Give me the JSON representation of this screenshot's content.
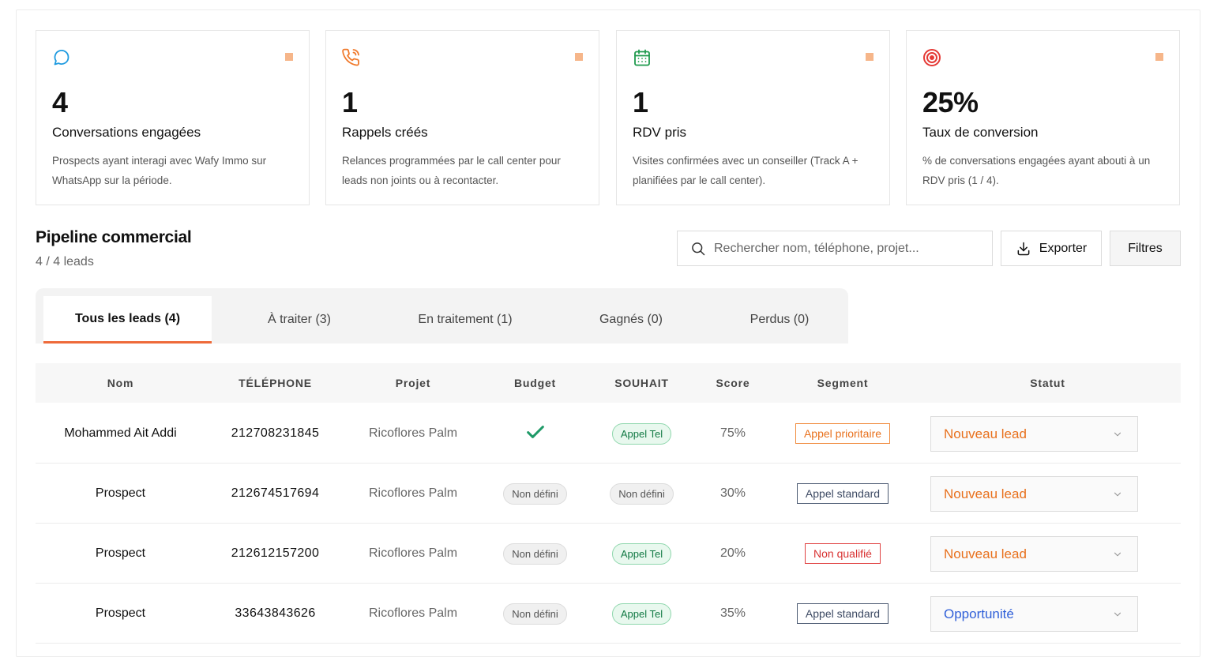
{
  "colors": {
    "accent": "#ee6a3a",
    "card_dot": "#f6b68a",
    "icon_chat": "#1f9be0",
    "icon_phone": "#f07a2c",
    "icon_calendar": "#1f9a4d",
    "icon_target": "#e53935",
    "check": "#1f9a68",
    "status_new": "#e8701c",
    "status_opportunity": "#2f5fd8"
  },
  "cards": [
    {
      "icon": "chat-bubble-icon",
      "value": "4",
      "title": "Conversations engagées",
      "desc": "Prospects ayant interagi avec Wafy Immo sur WhatsApp sur la période."
    },
    {
      "icon": "phone-callback-icon",
      "value": "1",
      "title": "Rappels créés",
      "desc": "Relances programmées par le call center pour leads non joints ou à recontacter."
    },
    {
      "icon": "calendar-icon",
      "value": "1",
      "title": "RDV pris",
      "desc": "Visites confirmées avec un conseiller (Track A + planifiées par le call center)."
    },
    {
      "icon": "target-icon",
      "value": "25%",
      "title": "Taux de conversion",
      "desc": "% de conversations engagées ayant abouti à un RDV pris (1 / 4)."
    }
  ],
  "pipeline": {
    "title": "Pipeline commercial",
    "subtitle": "4 / 4 leads",
    "search_placeholder": "Rechercher nom, téléphone, projet...",
    "export_label": "Exporter",
    "filters_label": "Filtres"
  },
  "tabs": [
    {
      "label": "Tous les leads (4)",
      "active": true
    },
    {
      "label": "À traiter (3)",
      "active": false
    },
    {
      "label": "En traitement (1)",
      "active": false
    },
    {
      "label": "Gagnés (0)",
      "active": false
    },
    {
      "label": "Perdus (0)",
      "active": false
    }
  ],
  "table": {
    "headers": [
      "Nom",
      "TÉLÉPHONE",
      "Projet",
      "Budget",
      "SOUHAIT",
      "Score",
      "Segment",
      "Statut"
    ],
    "rows": [
      {
        "name": "Mohammed Ait Addi",
        "phone": "212708231845",
        "project": "Ricoflores Palm",
        "budget": "check-icon",
        "souhait": "Appel Tel",
        "souhait_style": "green",
        "score": "75%",
        "segment": "Appel prioritaire",
        "segment_style": "orange",
        "status": "Nouveau lead",
        "status_style": "orange"
      },
      {
        "name": "Prospect",
        "phone": "212674517694",
        "project": "Ricoflores Palm",
        "budget": "Non défini",
        "souhait": "Non défini",
        "souhait_style": "gray",
        "score": "30%",
        "segment": "Appel standard",
        "segment_style": "blue",
        "status": "Nouveau lead",
        "status_style": "orange"
      },
      {
        "name": "Prospect",
        "phone": "212612157200",
        "project": "Ricoflores Palm",
        "budget": "Non défini",
        "souhait": "Appel Tel",
        "souhait_style": "green",
        "score": "20%",
        "segment": "Non qualifié",
        "segment_style": "red",
        "status": "Nouveau lead",
        "status_style": "orange"
      },
      {
        "name": "Prospect",
        "phone": "33643843626",
        "project": "Ricoflores Palm",
        "budget": "Non défini",
        "souhait": "Appel Tel",
        "souhait_style": "green",
        "score": "35%",
        "segment": "Appel standard",
        "segment_style": "blue",
        "status": "Opportunité",
        "status_style": "blue"
      }
    ]
  }
}
